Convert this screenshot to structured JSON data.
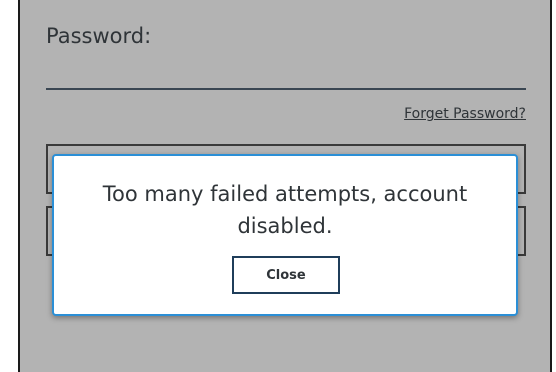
{
  "form": {
    "password_label": "Password:",
    "forget_password_link": "Forget Password?"
  },
  "dialog": {
    "message": "Too many failed attempts, account disabled.",
    "close_label": "Close"
  },
  "colors": {
    "overlay_background": "#b3b3b3",
    "dialog_border": "#2b8fd6",
    "button_border": "#1f3d5a",
    "text": "#2f3438"
  }
}
